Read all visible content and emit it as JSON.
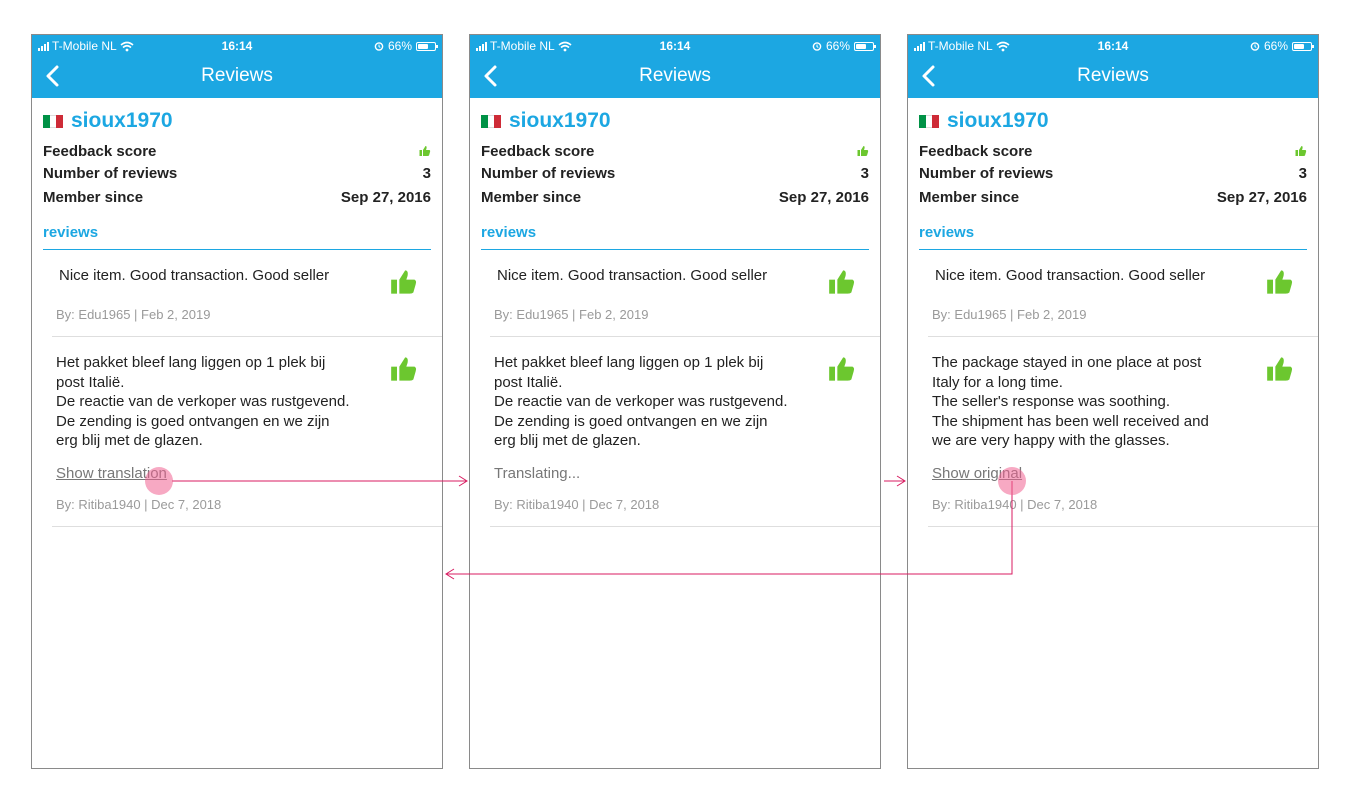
{
  "status_bar": {
    "carrier": "T-Mobile NL",
    "time": "16:14",
    "battery": "66%",
    "battery_level": 0.66
  },
  "nav": {
    "title": "Reviews"
  },
  "profile": {
    "username": "sioux1970",
    "flag_colors": [
      "#009246",
      "#ffffff",
      "#ce2b37"
    ],
    "feedback_label": "Feedback score",
    "reviews_label": "Number of reviews",
    "reviews_count": "3",
    "member_label": "Member since",
    "member_since": "Sep 27, 2016"
  },
  "reviews_heading": "reviews",
  "review_1": {
    "text": "Nice item. Good transaction. Good seller",
    "meta": "By: Edu1965 | Feb 2, 2019"
  },
  "review_2": {
    "meta": "By: Ritiba1940 | Dec 7, 2018",
    "original_lines": [
      "Het pakket bleef lang liggen op 1 plek bij",
      "post Italië.",
      "De reactie van de verkoper was rustgevend.",
      "De zending is goed ontvangen en we zijn",
      "erg blij met de glazen."
    ],
    "translated_lines": [
      "The package stayed in one place at post",
      "Italy for a long time.",
      "The seller's response was soothing.",
      "The shipment has been well received and",
      "we are very happy with the glasses."
    ]
  },
  "screens": [
    {
      "link": "Show translation",
      "translated": false,
      "underline": true
    },
    {
      "link": "Translating...",
      "translated": false,
      "underline": false
    },
    {
      "link": "Show original",
      "translated": true,
      "underline": true
    }
  ],
  "colors": {
    "accent": "#1ca7e2",
    "thumb": "#6cc72f",
    "flow_arrow": "#d81b60",
    "tap_marker": "#f06292"
  }
}
